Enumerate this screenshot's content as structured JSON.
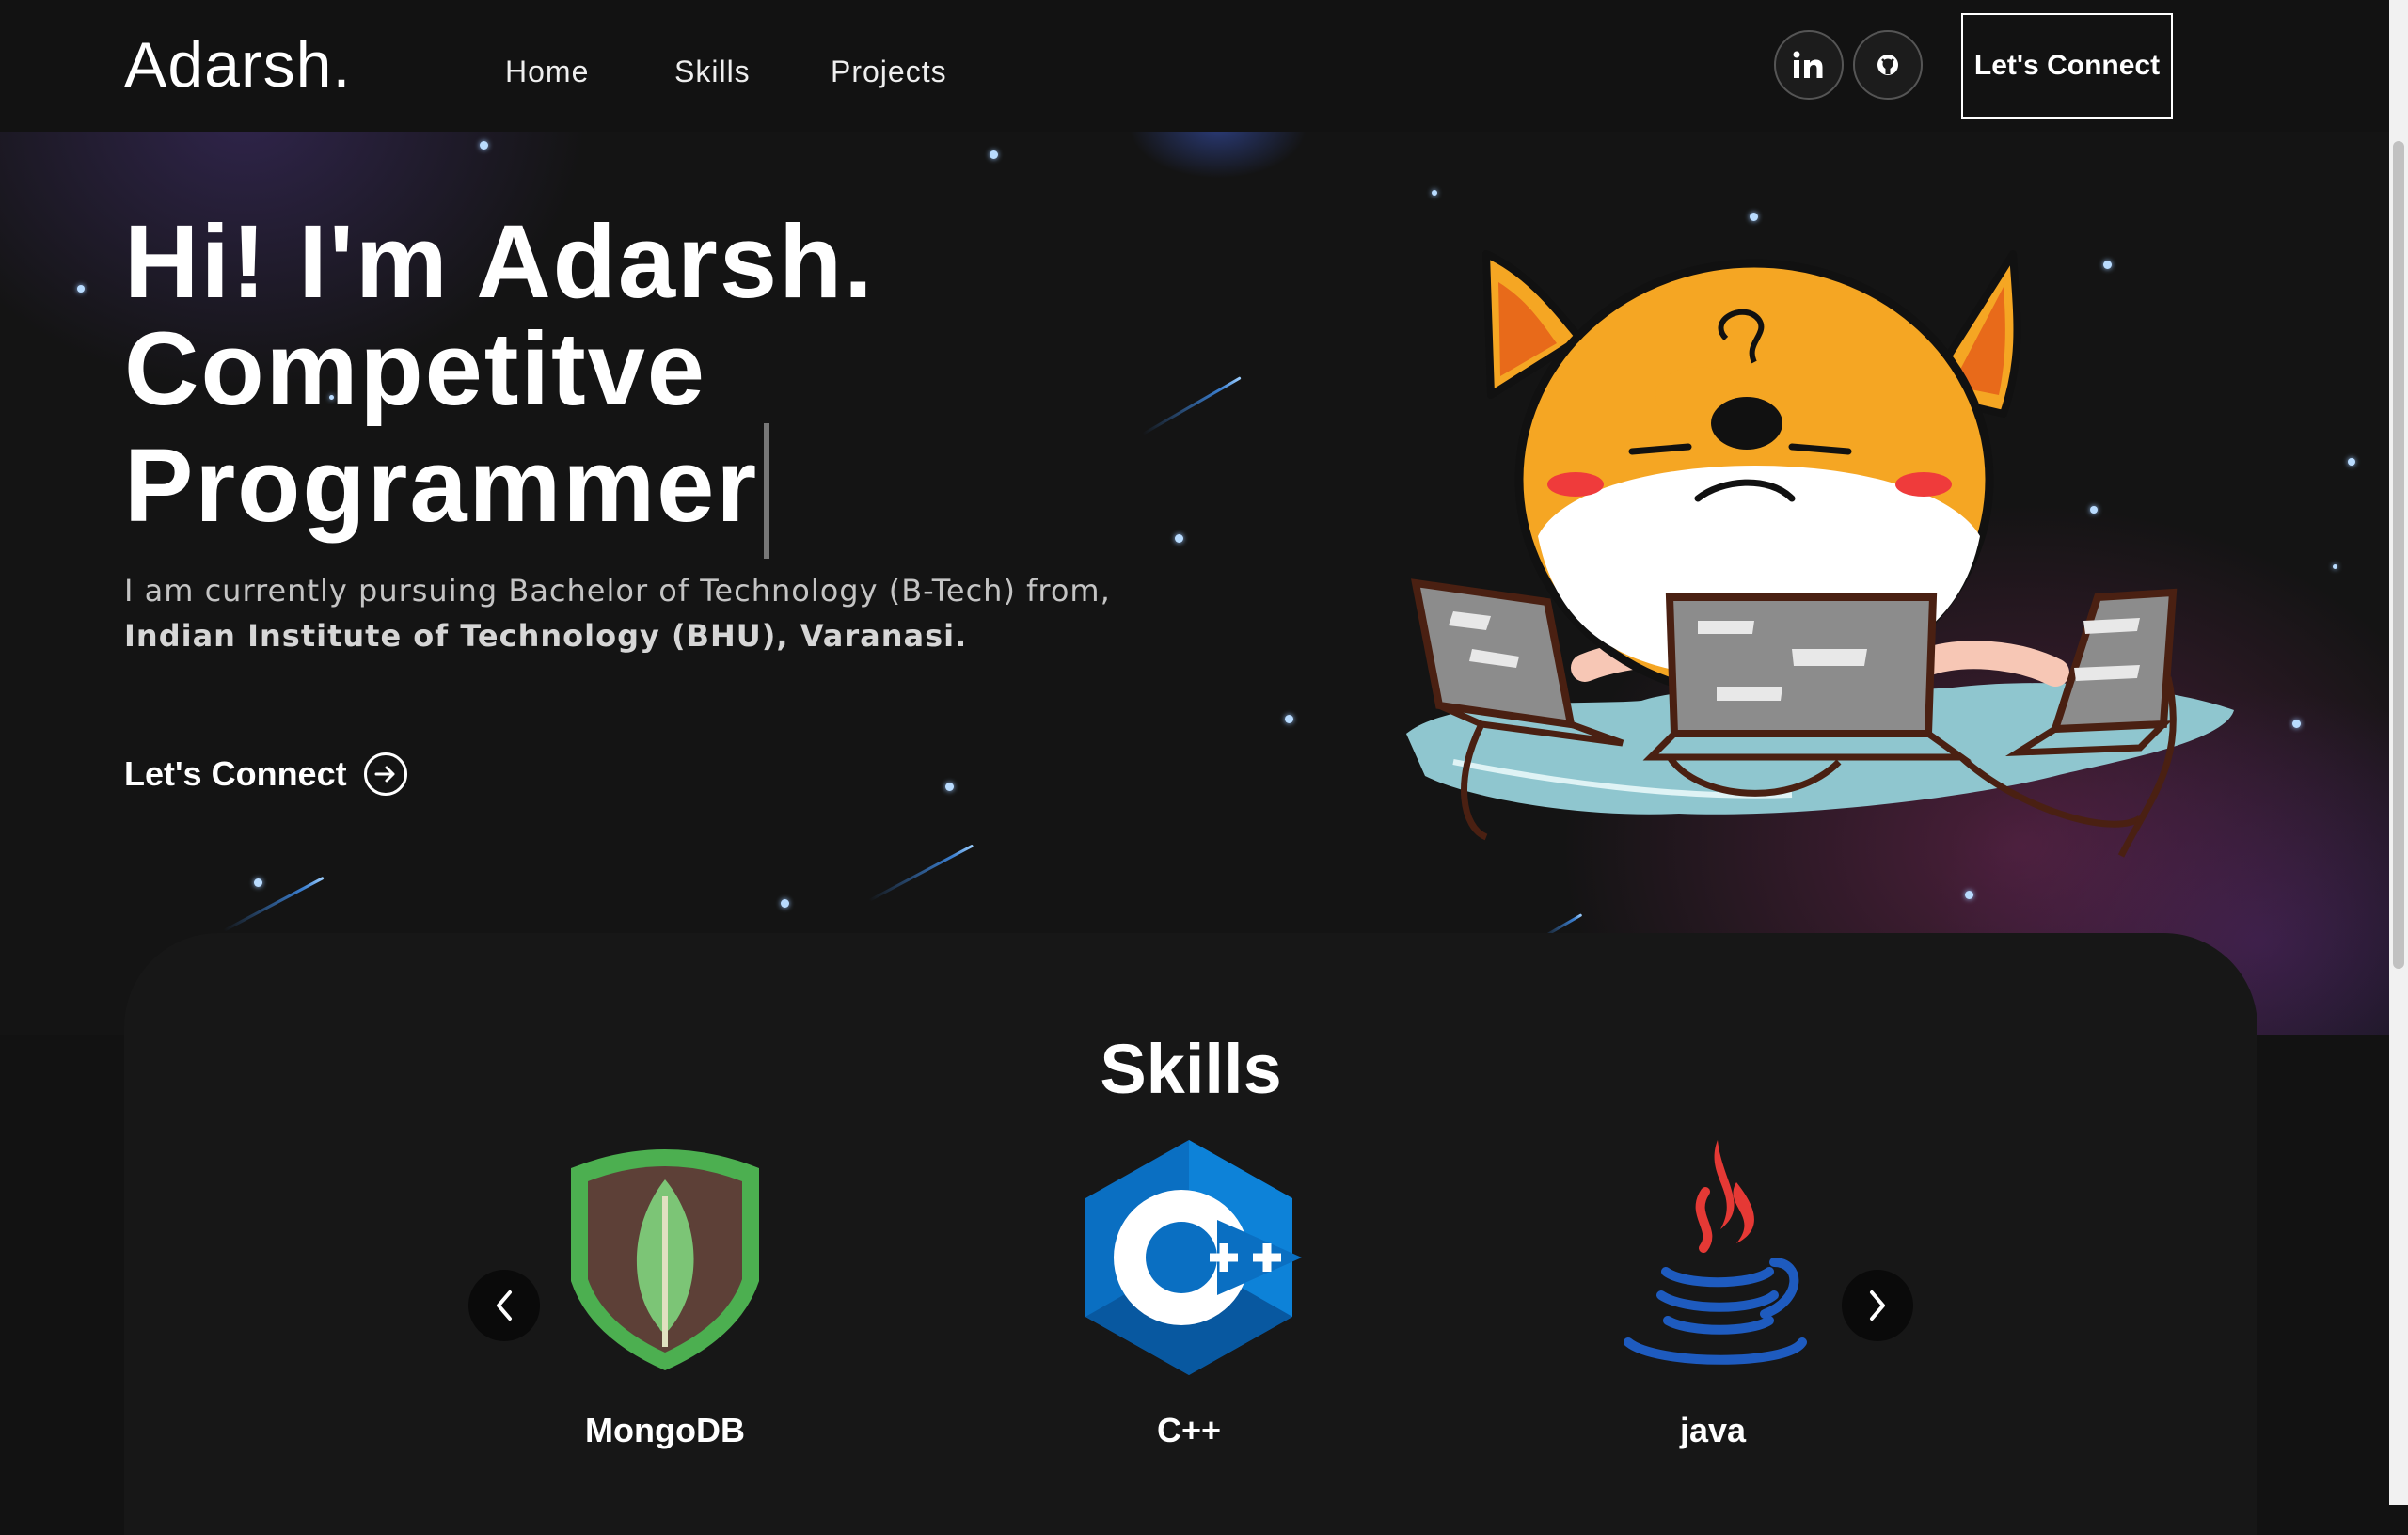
{
  "navbar": {
    "logo": "Adarsh.",
    "links": [
      "Home",
      "Skills",
      "Projects"
    ],
    "social_icons": [
      "linkedin-icon",
      "github-icon"
    ],
    "connect_label": "Let's Connect"
  },
  "hero": {
    "title_lines": [
      "Hi! I'm Adarsh.",
      "Competitve",
      "Programmer"
    ],
    "description_line1": "I am currently pursuing Bachelor of Technology (B-Tech) from,",
    "description_line2": "Indian Institute of Technology (BHU), Varanasi.",
    "cta_label": "Let's Connect"
  },
  "skills": {
    "title": "Skills",
    "items": [
      {
        "label": "MongoDB",
        "icon": "mongodb-icon"
      },
      {
        "label": "C++",
        "icon": "cpp-icon"
      },
      {
        "label": "java",
        "icon": "java-icon"
      }
    ]
  },
  "colors": {
    "background": "#121212",
    "card": "#171717",
    "mongodb_green": "#4caf50",
    "cpp_blue": "#0a6fc2",
    "java_red": "#e53935",
    "java_blue": "#1e5bbf"
  }
}
